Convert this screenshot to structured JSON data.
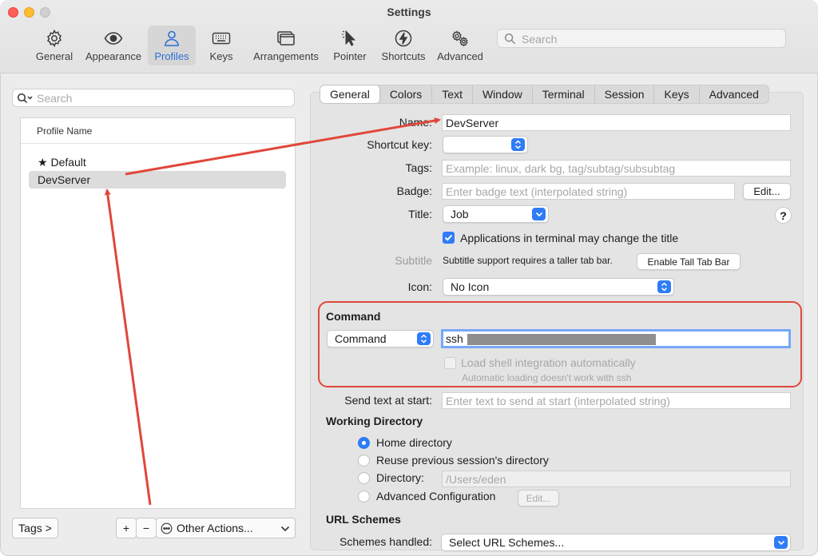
{
  "window": {
    "title": "Settings"
  },
  "toolbar": {
    "items": [
      {
        "label": "General",
        "icon": "gear-icon"
      },
      {
        "label": "Appearance",
        "icon": "eye-icon"
      },
      {
        "label": "Profiles",
        "icon": "person-icon",
        "active": true
      },
      {
        "label": "Keys",
        "icon": "keyboard-icon"
      },
      {
        "label": "Arrangements",
        "icon": "windows-icon"
      },
      {
        "label": "Pointer",
        "icon": "cursor-icon"
      },
      {
        "label": "Shortcuts",
        "icon": "bolt-icon"
      },
      {
        "label": "Advanced",
        "icon": "gears-icon"
      }
    ],
    "search_placeholder": "Search"
  },
  "sidebar": {
    "search_placeholder": "Search",
    "column_header": "Profile Name",
    "profiles": [
      {
        "name": "Default",
        "default_marker": "★"
      },
      {
        "name": "DevServer",
        "selected": true
      }
    ],
    "tags_button": "Tags >",
    "add_button": "+",
    "remove_button": "−",
    "other_actions": "Other Actions..."
  },
  "tabs": [
    "General",
    "Colors",
    "Text",
    "Window",
    "Terminal",
    "Session",
    "Keys",
    "Advanced"
  ],
  "general": {
    "name_label": "Name:",
    "name_value": "DevServer",
    "shortcut_label": "Shortcut key:",
    "shortcut_value": "",
    "tags_label": "Tags:",
    "tags_placeholder": "Example: linux, dark bg, tag/subtag/subsubtag",
    "badge_label": "Badge:",
    "badge_placeholder": "Enter badge text (interpolated string)",
    "badge_edit": "Edit...",
    "title_label": "Title:",
    "title_value": "Job",
    "help": "?",
    "apps_change_title": "Applications in terminal may change the title",
    "subtitle_label": "Subtitle",
    "subtitle_note": "Subtitle support requires a taller tab bar.",
    "tall_tab_button": "Enable Tall Tab Bar",
    "icon_label": "Icon:",
    "icon_value": "No Icon"
  },
  "command": {
    "heading": "Command",
    "type_value": "Command",
    "command_value": "ssh",
    "shell_integration": "Load shell integration automatically",
    "shell_note": "Automatic loading doesn't work with ssh"
  },
  "send_text": {
    "label": "Send text at start:",
    "placeholder": "Enter text to send at start (interpolated string)"
  },
  "working_dir": {
    "heading": "Working Directory",
    "home": "Home directory",
    "reuse": "Reuse previous session's directory",
    "directory": "Directory:",
    "directory_placeholder": "/Users/eden",
    "advanced": "Advanced Configuration",
    "advanced_edit": "Edit..."
  },
  "url_schemes": {
    "heading": "URL Schemes",
    "label": "Schemes handled:",
    "value": "Select URL Schemes..."
  },
  "colors": {
    "accent": "#2f7cf6",
    "annotation": "#e0473a"
  }
}
